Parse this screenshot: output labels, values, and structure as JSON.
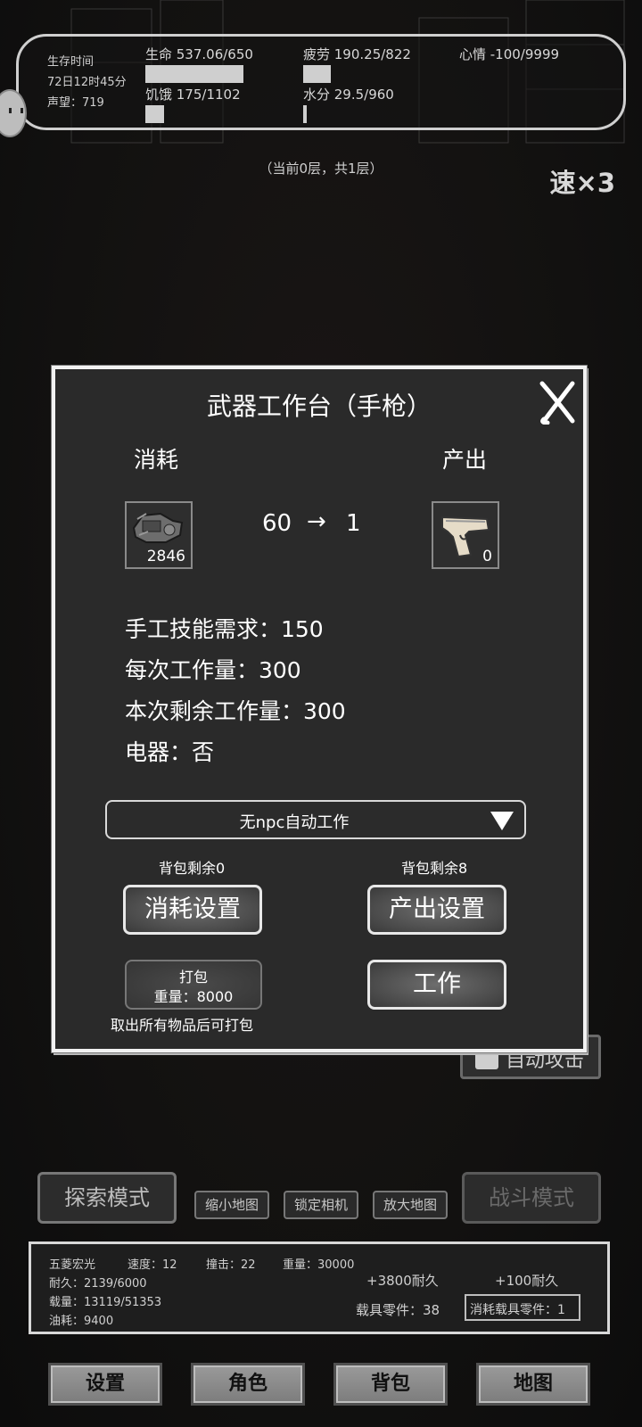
{
  "status": {
    "survival_label": "生存时间",
    "survival_time": "72日12时45分",
    "reputation": "声望：719",
    "life": "生命 537.06/650",
    "fatigue": "疲劳 190.25/822",
    "mood": "心情 -100/9999",
    "hunger": "饥饿 175/1102",
    "water": "水分 29.5/960",
    "life_fill": 0.826,
    "fatigue_fill": 0.231,
    "hunger_fill": 0.159,
    "water_fill": 0.031
  },
  "floor_info": "（当前0层，共1层）",
  "speed_label": "速×3",
  "dialog": {
    "title": "武器工作台（手枪）",
    "close_label": "X",
    "consume_header": "消耗",
    "output_header": "产出",
    "input_item": {
      "icon": "scrap-parts-icon",
      "count": "2846"
    },
    "output_item": {
      "icon": "pistol-icon",
      "count": "0"
    },
    "ratio_from": "60",
    "ratio_arrow": "→",
    "ratio_to": "1",
    "skill_req": "手工技能需求：150",
    "work_per_time": "每次工作量：300",
    "remaining_work": "本次剩余工作量：300",
    "electric": "电器：否",
    "npc_select": "无npc自动工作",
    "bag_left_consume": "背包剩余0",
    "bag_left_output": "背包剩余8",
    "consume_settings": "消耗设置",
    "output_settings": "产出设置",
    "pack_label": "打包",
    "pack_weight": "重量：8000",
    "pack_hint": "取出所有物品后可打包",
    "work_button": "工作"
  },
  "auto_attack": "自动攻击",
  "modes": {
    "explore": "探索模式",
    "shrink_map": "缩小地图",
    "lock_camera": "锁定相机",
    "enlarge_map": "放大地图",
    "battle": "战斗模式"
  },
  "vehicle": {
    "name": "五菱宏光",
    "speed": "速度：12",
    "impact": "撞击：22",
    "weight": "重量：30000",
    "durability": "耐久：2139/6000",
    "load": "载量：13119/51353",
    "fuel": "油耗：9400",
    "repair1": "+3800耐久",
    "repair2": "+100耐久",
    "parts": "载具零件：38",
    "consume_parts": "消耗载具零件：1"
  },
  "nav": {
    "settings": "设置",
    "character": "角色",
    "backpack": "背包",
    "map": "地图"
  },
  "colors": {
    "panel": "#2a2a2a",
    "border": "#f2f2f2",
    "bar": "#cfcfcf"
  }
}
